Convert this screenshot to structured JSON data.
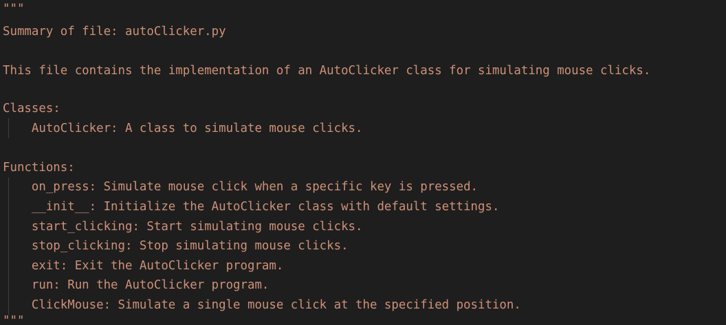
{
  "editor": {
    "text_color": "#ce9178",
    "background_color": "#1e1e1e",
    "lines": [
      "\"\"\"",
      "Summary of file: autoClicker.py",
      "",
      "This file contains the implementation of an AutoClicker class for simulating mouse clicks.",
      "",
      "Classes:",
      "    AutoClicker: A class to simulate mouse clicks.",
      "",
      "Functions:",
      "    on_press: Simulate mouse click when a specific key is pressed.",
      "    __init__: Initialize the AutoClicker class with default settings.",
      "    start_clicking: Start simulating mouse clicks.",
      "    stop_clicking: Stop simulating mouse clicks.",
      "    exit: Exit the AutoClicker program.",
      "    run: Run the AutoClicker program.",
      "    ClickMouse: Simulate a single mouse click at the specified position.",
      "\"\"\""
    ]
  }
}
